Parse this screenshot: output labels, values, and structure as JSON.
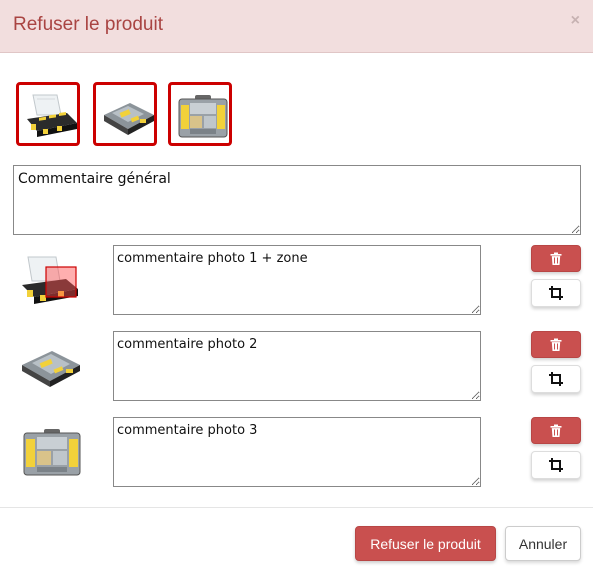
{
  "modal": {
    "title": "Refuser le produit",
    "close_label": "×"
  },
  "thumbnails": [
    {
      "icon": "open-organizer-box-image"
    },
    {
      "icon": "organizer-box-angled-image"
    },
    {
      "icon": "organizer-box-front-image"
    }
  ],
  "general_comment": {
    "value": "Commentaire général"
  },
  "photo_comments": [
    {
      "icon": "open-organizer-box-image",
      "value": "commentaire photo 1 + zone",
      "has_zone": true
    },
    {
      "icon": "organizer-box-angled-image",
      "value": "commentaire photo 2",
      "has_zone": false
    },
    {
      "icon": "organizer-box-front-image",
      "value": "commentaire photo 3",
      "has_zone": false
    }
  ],
  "row_actions": {
    "delete_icon": "trash-icon",
    "crop_icon": "crop-icon"
  },
  "footer": {
    "refuse_label": "Refuser le produit",
    "cancel_label": "Annuler"
  },
  "colors": {
    "header_bg": "#f2dede",
    "title_text": "#a94442",
    "danger": "#c9504f",
    "thumb_border": "#cc0000"
  }
}
